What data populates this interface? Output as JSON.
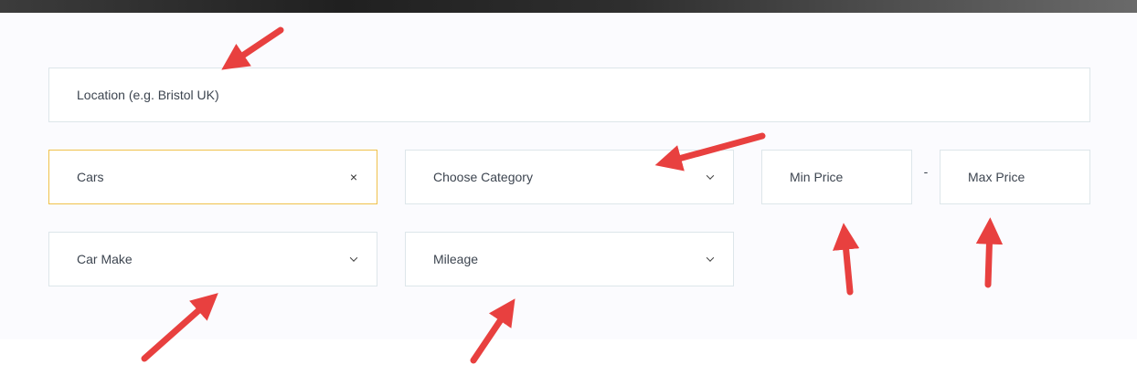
{
  "search": {
    "location_placeholder": "Location (e.g. Bristol UK)",
    "vehicle_type_value": "Cars",
    "clear_symbol": "×",
    "category_placeholder": "Choose Category",
    "min_price_placeholder": "Min Price",
    "price_separator": "-",
    "max_price_placeholder": "Max Price",
    "car_make_placeholder": "Car Make",
    "mileage_placeholder": "Mileage"
  },
  "colors": {
    "panel_bg": "#fbfbfe",
    "field_border": "#dde6ea",
    "active_border": "#f0c24b",
    "annotation_arrow": "#e8403f"
  }
}
